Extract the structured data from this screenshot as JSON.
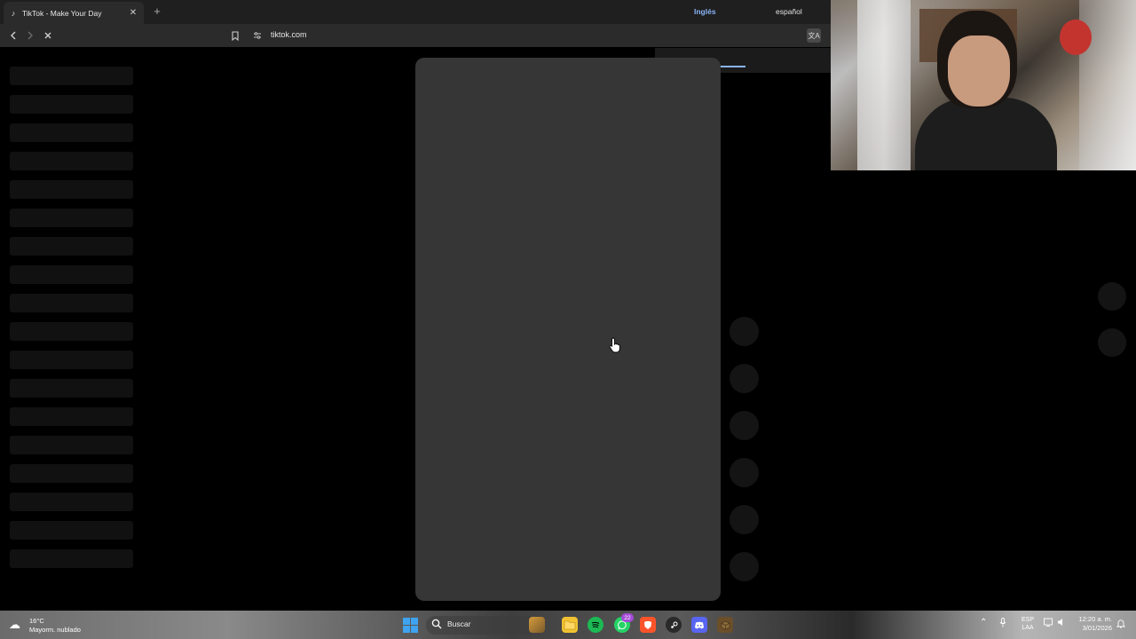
{
  "browser": {
    "tab_title": "TikTok - Make Your Day",
    "tab_close_icon": "close-icon",
    "new_tab_label": "+",
    "url": "tiktok.com",
    "back_icon": "chevron-left-icon",
    "forward_icon": "chevron-right-icon",
    "stop_icon": "close-icon"
  },
  "translate": {
    "active_language": "Inglés",
    "other_language": "español",
    "accent_color": "#8ab4f8"
  },
  "page": {
    "background": "#000000",
    "video_placeholder_color": "#363636"
  },
  "taskbar": {
    "weather_temp": "16°C",
    "weather_desc": "Mayorm. nublado",
    "search_label": "Buscar",
    "whatsapp_badge": "22",
    "lang_line1": "ESP",
    "lang_line2": "LAA",
    "time": "12:20 a. m.",
    "date": "3/01/2026"
  }
}
